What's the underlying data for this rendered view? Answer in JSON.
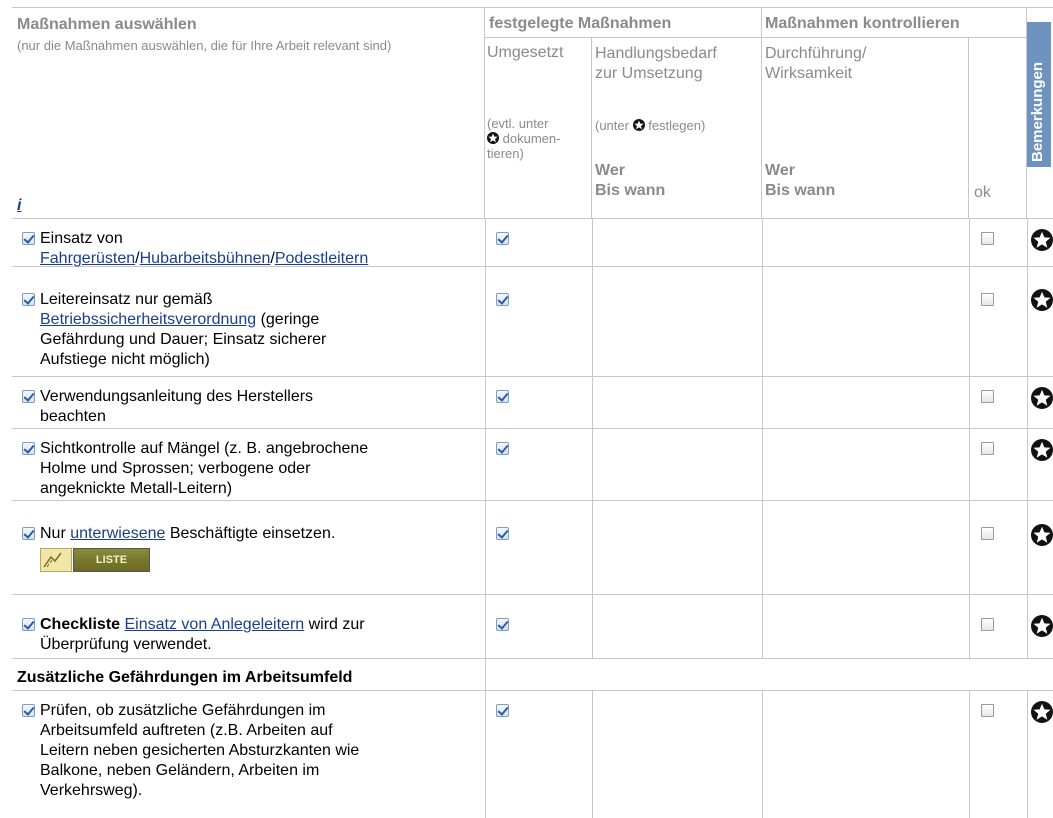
{
  "header": {
    "select_title": "Maßnahmen auswählen",
    "select_hint": "(nur die Maßnahmen auswählen, die für Ihre Arbeit relevant sind)",
    "info_link": "i",
    "fixed_title": "festgelegte Maßnahmen",
    "control_title": "Maßnahmen kontrollieren",
    "remarks_tab": "Bemerkungen",
    "col_implemented": "Umgesetzt",
    "col_implemented_hint_1": "(evtl. unter",
    "col_implemented_hint_2": "dokumen-",
    "col_implemented_hint_3": "tieren)",
    "col_action_1": "Handlungsbedarf",
    "col_action_2": "zur Umsetzung",
    "col_action_hint_1": "(unter",
    "col_action_hint_2": "festlegen)",
    "col_who": "Wer",
    "col_until": "Bis wann",
    "col_exec_1": "Durchführung/",
    "col_exec_2": "Wirksamkeit",
    "col_who2": "Wer",
    "col_until2": "Bis wann",
    "col_ok": "ok"
  },
  "rows": [
    {
      "t1": "Einsatz von",
      "l1": "Fahrgerüsten",
      "s1": "/",
      "l2": "Hubarbeitsbühnen",
      "s2": "/",
      "l3": "Podestleitern"
    },
    {
      "t1": "Leitereinsatz nur gemäß",
      "l1": "Betriebssicherheitsverordnung",
      "t2": " (geringe",
      "t3": "Gefährdung und Dauer; Einsatz sicherer",
      "t4": "Aufstiege nicht möglich)"
    },
    {
      "t1": "Verwendungsanleitung des Herstellers",
      "t2": "beachten"
    },
    {
      "t1": "Sichtkontrolle auf Mängel (z. B. angebrochene",
      "t2": "Holme und Sprossen; verbogene oder",
      "t3": "angeknickte Metall-Leitern)"
    },
    {
      "t1": "Nur ",
      "l1": "unterwiesene",
      "t2": " Beschäftigte einsetzen.",
      "badge": "LISTE"
    },
    {
      "b1": "Checkliste",
      "l1": "Einsatz von Anlegeleitern",
      "t2": " wird zur",
      "t3": "Überprüfung verwendet."
    },
    {
      "section": "Zusätzliche Gefährdungen im Arbeitsumfeld"
    },
    {
      "t1": "Prüfen, ob zusätzliche Gefährdungen im",
      "t2": "Arbeitsumfeld auftreten (z.B. Arbeiten auf",
      "t3": "Leitern neben gesicherten Absturzkanten wie",
      "t4": "Balkone, neben Geländern, Arbeiten im",
      "t5": "Verkehrsweg)."
    }
  ],
  "colors": {
    "grid": "#c8c8c8",
    "header_text": "#8a8a8a",
    "link": "#1a3e8f",
    "remarks_tab": "#6f93bf"
  },
  "icons": [
    "star-icon",
    "checkbox-checked",
    "checkbox-unchecked",
    "liste-badge-icon"
  ]
}
